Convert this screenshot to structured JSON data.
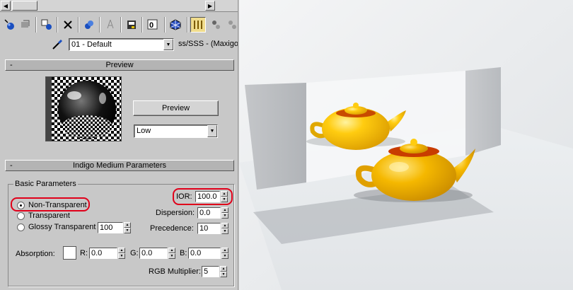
{
  "toolbar": {
    "icons": [
      "get-material-icon",
      "put-to-scene-icon",
      "assign-material-icon",
      "reset-icon",
      "make-copy-icon",
      "make-unique-icon",
      "put-to-library-icon",
      "material-effects-channel-icon",
      "show-in-viewport-icon",
      "show-end-result-icon",
      "go-to-parent-icon",
      "go-forward-icon"
    ]
  },
  "material": {
    "name": "01 - Default",
    "type_text": "ss/SSS - (Maxigo)"
  },
  "preview_rollout": {
    "title": "Preview",
    "collapse": "-",
    "preview_button": "Preview",
    "quality_value": "Low"
  },
  "medium_rollout": {
    "title": "Indigo Medium Parameters",
    "collapse": "-",
    "group_title": "Basic Parameters",
    "options": [
      {
        "label": "Non-Transparent",
        "selected": true
      },
      {
        "label": "Transparent",
        "selected": false
      },
      {
        "label": "Glossy Transparent",
        "selected": false
      }
    ],
    "glossy_value": "100",
    "ior_label": "IOR:",
    "ior_value": "100.0",
    "dispersion_label": "Dispersion:",
    "dispersion_value": "0.0",
    "precedence_label": "Precedence:",
    "precedence_value": "10",
    "absorption_label": "Absorption:",
    "absorption_color": "#ffffff",
    "r_label": "R:",
    "r_value": "0.0",
    "g_label": "G:",
    "g_value": "0.0",
    "b_label": "B:",
    "b_value": "0.0",
    "rgb_multiplier_label": "RGB Multiplier:",
    "rgb_multiplier_value": "5"
  },
  "colors": {
    "highlight": "#e0001a",
    "teapot": "#f5b800",
    "active_tool": "#f0dc8c"
  }
}
